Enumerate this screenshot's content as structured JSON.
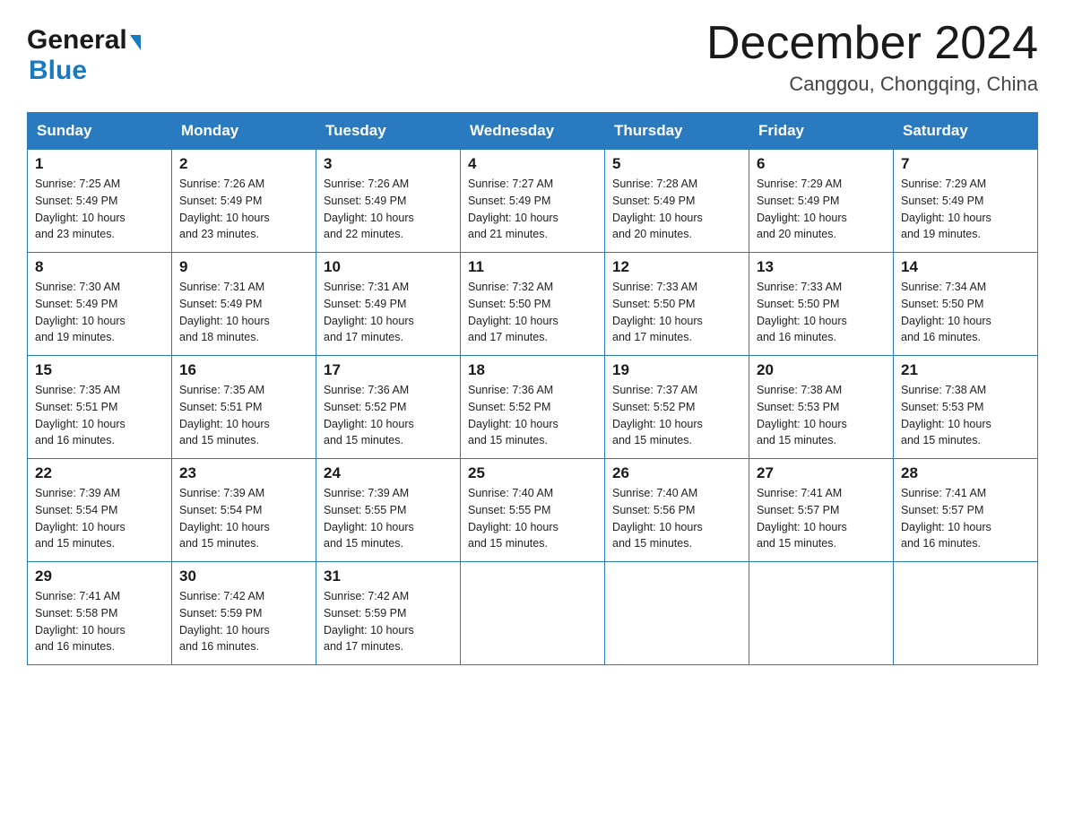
{
  "header": {
    "logo": {
      "general": "General",
      "blue": "Blue",
      "arrow": "▶"
    },
    "month_title": "December 2024",
    "location": "Canggou, Chongqing, China"
  },
  "weekdays": [
    "Sunday",
    "Monday",
    "Tuesday",
    "Wednesday",
    "Thursday",
    "Friday",
    "Saturday"
  ],
  "weeks": [
    [
      {
        "day": "1",
        "sunrise": "7:25 AM",
        "sunset": "5:49 PM",
        "daylight": "10 hours and 23 minutes."
      },
      {
        "day": "2",
        "sunrise": "7:26 AM",
        "sunset": "5:49 PM",
        "daylight": "10 hours and 23 minutes."
      },
      {
        "day": "3",
        "sunrise": "7:26 AM",
        "sunset": "5:49 PM",
        "daylight": "10 hours and 22 minutes."
      },
      {
        "day": "4",
        "sunrise": "7:27 AM",
        "sunset": "5:49 PM",
        "daylight": "10 hours and 21 minutes."
      },
      {
        "day": "5",
        "sunrise": "7:28 AM",
        "sunset": "5:49 PM",
        "daylight": "10 hours and 20 minutes."
      },
      {
        "day": "6",
        "sunrise": "7:29 AM",
        "sunset": "5:49 PM",
        "daylight": "10 hours and 20 minutes."
      },
      {
        "day": "7",
        "sunrise": "7:29 AM",
        "sunset": "5:49 PM",
        "daylight": "10 hours and 19 minutes."
      }
    ],
    [
      {
        "day": "8",
        "sunrise": "7:30 AM",
        "sunset": "5:49 PM",
        "daylight": "10 hours and 19 minutes."
      },
      {
        "day": "9",
        "sunrise": "7:31 AM",
        "sunset": "5:49 PM",
        "daylight": "10 hours and 18 minutes."
      },
      {
        "day": "10",
        "sunrise": "7:31 AM",
        "sunset": "5:49 PM",
        "daylight": "10 hours and 17 minutes."
      },
      {
        "day": "11",
        "sunrise": "7:32 AM",
        "sunset": "5:50 PM",
        "daylight": "10 hours and 17 minutes."
      },
      {
        "day": "12",
        "sunrise": "7:33 AM",
        "sunset": "5:50 PM",
        "daylight": "10 hours and 17 minutes."
      },
      {
        "day": "13",
        "sunrise": "7:33 AM",
        "sunset": "5:50 PM",
        "daylight": "10 hours and 16 minutes."
      },
      {
        "day": "14",
        "sunrise": "7:34 AM",
        "sunset": "5:50 PM",
        "daylight": "10 hours and 16 minutes."
      }
    ],
    [
      {
        "day": "15",
        "sunrise": "7:35 AM",
        "sunset": "5:51 PM",
        "daylight": "10 hours and 16 minutes."
      },
      {
        "day": "16",
        "sunrise": "7:35 AM",
        "sunset": "5:51 PM",
        "daylight": "10 hours and 15 minutes."
      },
      {
        "day": "17",
        "sunrise": "7:36 AM",
        "sunset": "5:52 PM",
        "daylight": "10 hours and 15 minutes."
      },
      {
        "day": "18",
        "sunrise": "7:36 AM",
        "sunset": "5:52 PM",
        "daylight": "10 hours and 15 minutes."
      },
      {
        "day": "19",
        "sunrise": "7:37 AM",
        "sunset": "5:52 PM",
        "daylight": "10 hours and 15 minutes."
      },
      {
        "day": "20",
        "sunrise": "7:38 AM",
        "sunset": "5:53 PM",
        "daylight": "10 hours and 15 minutes."
      },
      {
        "day": "21",
        "sunrise": "7:38 AM",
        "sunset": "5:53 PM",
        "daylight": "10 hours and 15 minutes."
      }
    ],
    [
      {
        "day": "22",
        "sunrise": "7:39 AM",
        "sunset": "5:54 PM",
        "daylight": "10 hours and 15 minutes."
      },
      {
        "day": "23",
        "sunrise": "7:39 AM",
        "sunset": "5:54 PM",
        "daylight": "10 hours and 15 minutes."
      },
      {
        "day": "24",
        "sunrise": "7:39 AM",
        "sunset": "5:55 PM",
        "daylight": "10 hours and 15 minutes."
      },
      {
        "day": "25",
        "sunrise": "7:40 AM",
        "sunset": "5:55 PM",
        "daylight": "10 hours and 15 minutes."
      },
      {
        "day": "26",
        "sunrise": "7:40 AM",
        "sunset": "5:56 PM",
        "daylight": "10 hours and 15 minutes."
      },
      {
        "day": "27",
        "sunrise": "7:41 AM",
        "sunset": "5:57 PM",
        "daylight": "10 hours and 15 minutes."
      },
      {
        "day": "28",
        "sunrise": "7:41 AM",
        "sunset": "5:57 PM",
        "daylight": "10 hours and 16 minutes."
      }
    ],
    [
      {
        "day": "29",
        "sunrise": "7:41 AM",
        "sunset": "5:58 PM",
        "daylight": "10 hours and 16 minutes."
      },
      {
        "day": "30",
        "sunrise": "7:42 AM",
        "sunset": "5:59 PM",
        "daylight": "10 hours and 16 minutes."
      },
      {
        "day": "31",
        "sunrise": "7:42 AM",
        "sunset": "5:59 PM",
        "daylight": "10 hours and 17 minutes."
      },
      null,
      null,
      null,
      null
    ]
  ],
  "labels": {
    "sunrise_prefix": "Sunrise: ",
    "sunset_prefix": "Sunset: ",
    "daylight_prefix": "Daylight: "
  }
}
